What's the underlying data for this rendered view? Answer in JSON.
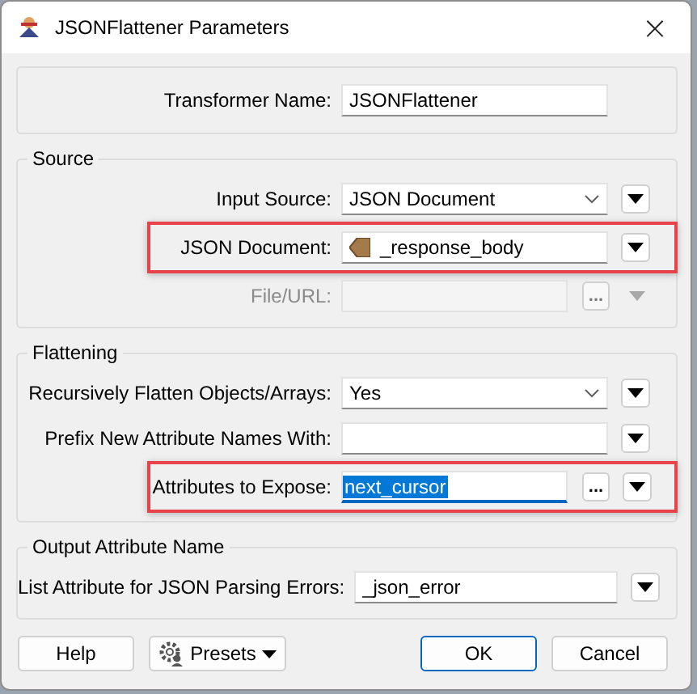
{
  "window": {
    "title": "JSONFlattener Parameters",
    "close": "×"
  },
  "transformer_name": {
    "label": "Transformer Name:",
    "value": "JSONFlattener"
  },
  "groups": [
    {
      "title": "Source",
      "rows": [
        {
          "kind": "combo",
          "label": "Input Source:",
          "value": "JSON Document",
          "disabled": false,
          "highlighted": false,
          "text_selected": false
        },
        {
          "kind": "attribute",
          "label": "JSON Document:",
          "value": "_response_body",
          "disabled": false,
          "highlighted": true,
          "text_selected": false
        },
        {
          "kind": "text",
          "label": "File/URL:",
          "browse": "...",
          "disabled": true,
          "highlighted": false,
          "text_selected": false
        }
      ]
    },
    {
      "title": "Flattening",
      "rows": [
        {
          "kind": "combo",
          "label": "Recursively Flatten Objects/Arrays:",
          "value": "Yes",
          "disabled": false,
          "highlighted": false,
          "text_selected": false
        },
        {
          "kind": "text",
          "label": "Prefix New Attribute Names With:",
          "disabled": false,
          "highlighted": false,
          "text_selected": false
        },
        {
          "kind": "text",
          "label": "Attributes to Expose:",
          "value": "next_cursor",
          "browse": "...",
          "disabled": false,
          "highlighted": true,
          "text_selected": true
        }
      ]
    },
    {
      "title": "Output Attribute Name",
      "rows": [
        {
          "kind": "text",
          "label": "List Attribute for JSON Parsing Errors:",
          "value": "_json_error",
          "disabled": false,
          "highlighted": false,
          "text_selected": false
        }
      ]
    }
  ],
  "buttons": [
    {
      "kind": "plain",
      "label": "Help",
      "default": false
    },
    {
      "kind": "presets",
      "label": "Presets",
      "default": false
    },
    {
      "kind": "plain",
      "label": "OK",
      "default": true
    },
    {
      "kind": "plain",
      "label": "Cancel",
      "default": false
    }
  ]
}
